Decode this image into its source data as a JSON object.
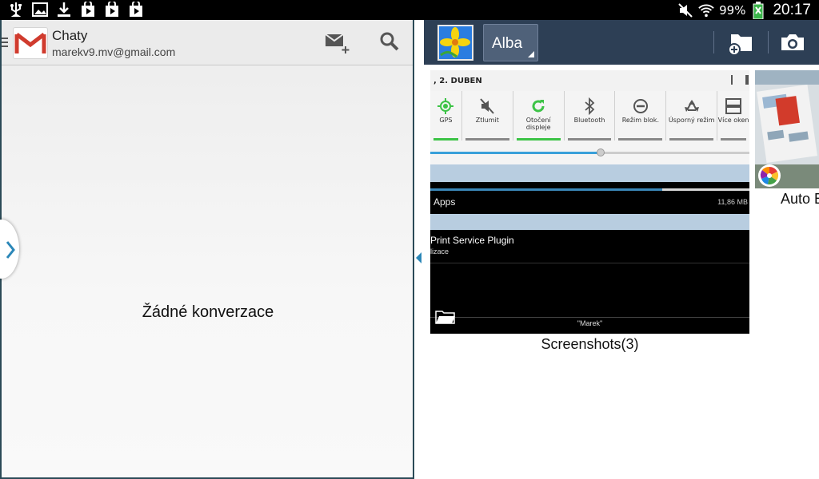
{
  "status_bar": {
    "battery_text": "99%",
    "time": "20:17"
  },
  "gmail": {
    "title": "Chaty",
    "account": "marekv9.mv@gmail.com",
    "empty_message": "Žádné konverzace"
  },
  "gallery": {
    "album_dropdown_label": "Alba",
    "albums": [
      {
        "caption": "Screenshots(3)"
      },
      {
        "caption": "Auto B"
      }
    ],
    "thumbnail": {
      "date_text": ", 2. DUBEN",
      "quick_settings": [
        {
          "label": "GPS",
          "on": true
        },
        {
          "label": "Ztlumit",
          "on": false
        },
        {
          "label": "Otočení displeje",
          "on": true
        },
        {
          "label": "Bluetooth",
          "on": false
        },
        {
          "label": "Režim blok.",
          "on": false
        },
        {
          "label": "Úsporný režim",
          "on": false
        },
        {
          "label": "Více oken",
          "on": false
        }
      ],
      "apps_label": "Apps",
      "apps_size": "11,86 MB",
      "plugin_title": "Print Service Plugin",
      "plugin_sub": "lizace",
      "owner_label": "\"Marek\""
    }
  },
  "colors": {
    "gallery_bar": "#2d3f55",
    "pane_border": "#2b4a57",
    "qs_on": "#3cc346"
  }
}
